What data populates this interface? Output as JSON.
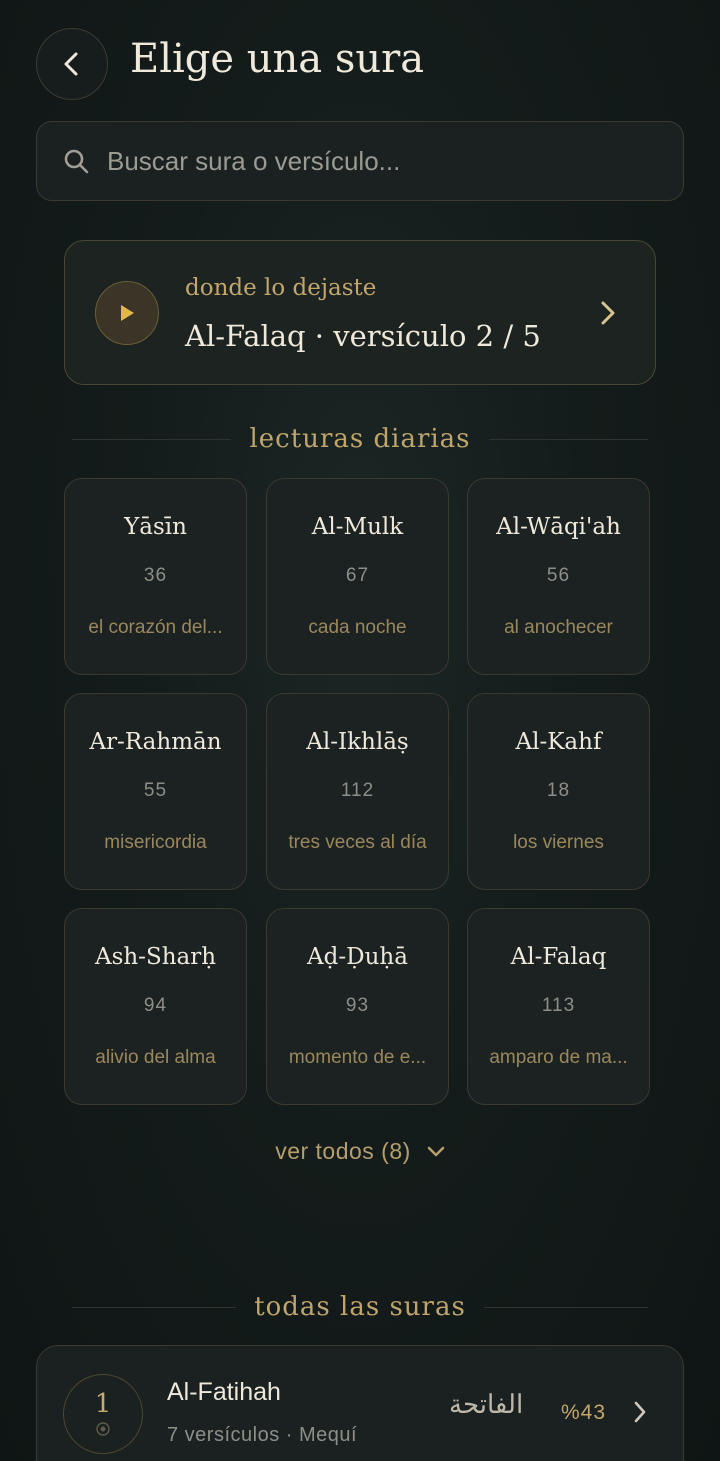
{
  "header": {
    "title": "Elige una sura",
    "back_icon": "chevron-left-icon"
  },
  "search": {
    "placeholder": "Buscar sura o versículo...",
    "icon": "search-icon"
  },
  "continue": {
    "label": "donde lo dejaste",
    "title": "Al-Falaq · versículo 2 / 5",
    "play_icon": "play-icon",
    "chevron_icon": "chevron-right-icon"
  },
  "daily": {
    "heading": "lecturas diarias",
    "tiles": [
      {
        "name": "Yāsīn",
        "number": "36",
        "subtitle": "el corazón del..."
      },
      {
        "name": "Al-Mulk",
        "number": "67",
        "subtitle": "cada noche"
      },
      {
        "name": "Al-Wāqi'ah",
        "number": "56",
        "subtitle": "al anochecer"
      },
      {
        "name": "Ar-Rahmān",
        "number": "55",
        "subtitle": "misericordia"
      },
      {
        "name": "Al-Ikhlāṣ",
        "number": "112",
        "subtitle": "tres veces al día"
      },
      {
        "name": "Al-Kahf",
        "number": "18",
        "subtitle": "los viernes"
      },
      {
        "name": "Ash-Sharḥ",
        "number": "94",
        "subtitle": "alivio del alma"
      },
      {
        "name": "Aḍ-Ḍuḥā",
        "number": "93",
        "subtitle": "momento de e..."
      },
      {
        "name": "Al-Falaq",
        "number": "113",
        "subtitle": "amparo de ma..."
      }
    ],
    "see_all": "ver todos (8)"
  },
  "all": {
    "heading": "todas las suras",
    "items": [
      {
        "number": "1",
        "name": "Al-Fatihah",
        "meta": "7 versículos · Mequí",
        "arabic": "الفاتحة",
        "progress_label": "%43",
        "progress": 0.43
      }
    ]
  },
  "colors": {
    "accent": "#c3a66a",
    "background": "#141c1b",
    "card": "#1b2221",
    "border": "#3a3a2e"
  }
}
